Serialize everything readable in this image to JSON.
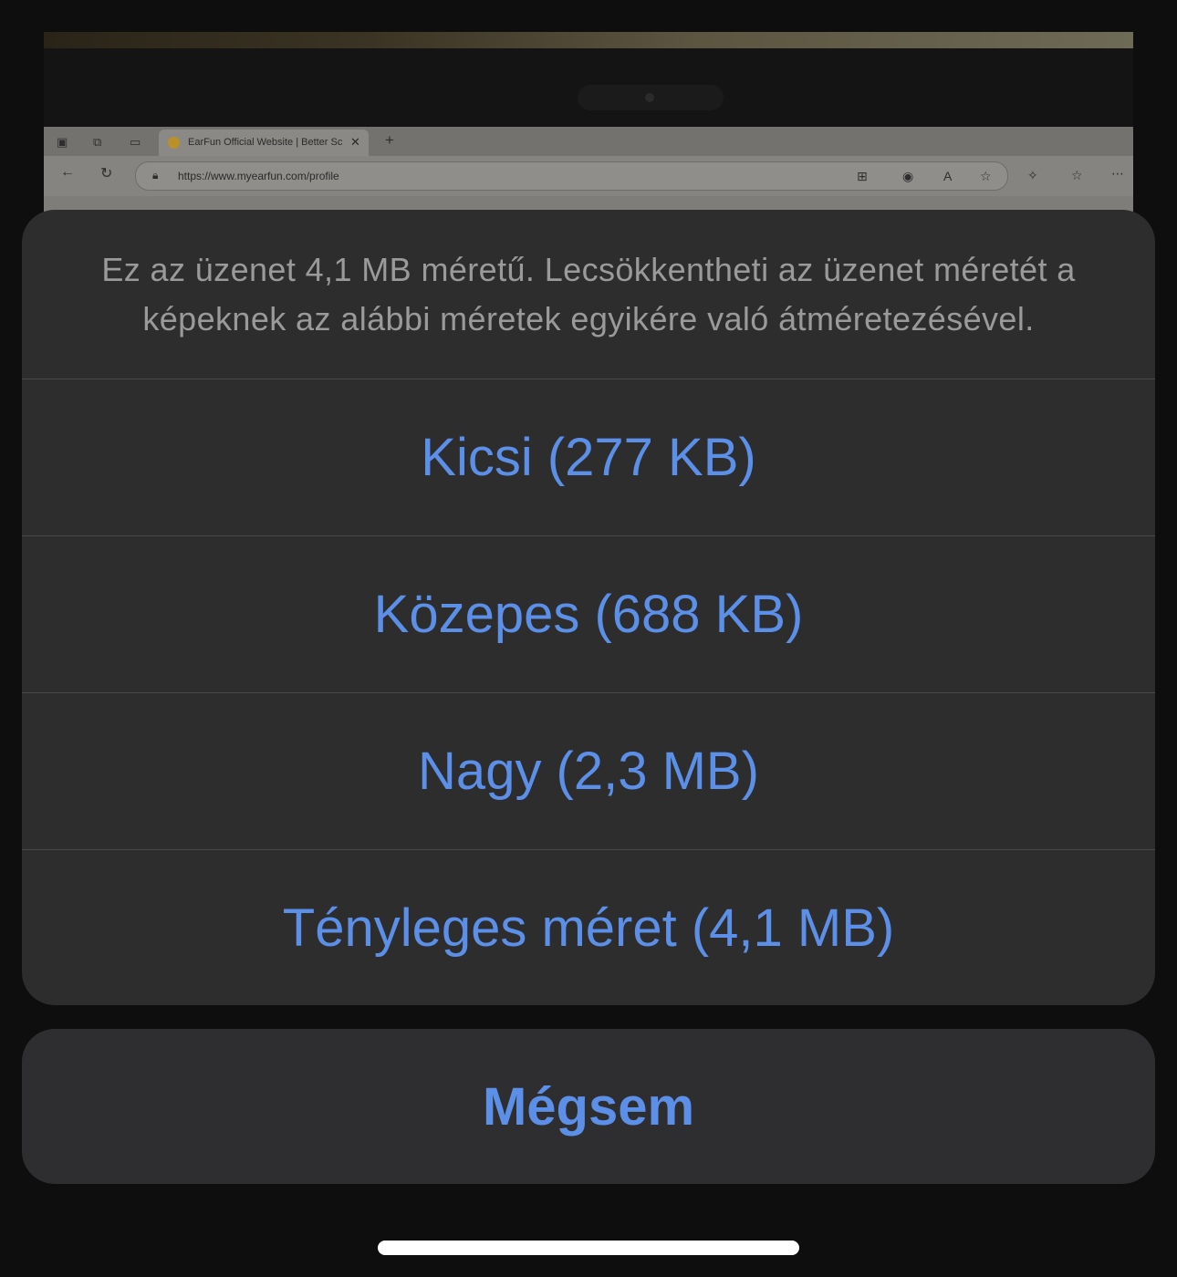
{
  "background_browser": {
    "tab_title": "EarFun Official Website | Better Sc",
    "url": "https://www.myearfun.com/profile",
    "new_tab": "+",
    "tab_close": "✕"
  },
  "action_sheet": {
    "message": "Ez az üzenet 4,1 MB méretű. Lecsökkentheti az üzenet méretét a képeknek az alábbi méretek egyikére való átméretezésével.",
    "options": [
      {
        "label": "Kicsi (277 KB)"
      },
      {
        "label": "Közepes (688 KB)"
      },
      {
        "label": "Nagy (2,3 MB)"
      },
      {
        "label": "Tényleges méret (4,1 MB)"
      }
    ],
    "cancel_label": "Mégsem"
  },
  "colors": {
    "accent": "#5b8fe8",
    "sheet_bg": "#2d2d2d",
    "message_text": "#9a9a9a"
  }
}
